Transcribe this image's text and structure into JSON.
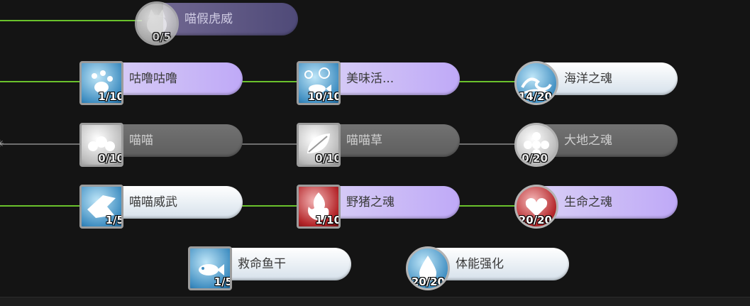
{
  "skill_tree": {
    "nodes": [
      {
        "id": "miao_jia_hu_wei",
        "label": "喵假虎威",
        "count": "0/5",
        "icon": "cat-face-icon",
        "state": "locked"
      },
      {
        "id": "gu_lu",
        "label": "咕噜咕噜",
        "count": "1/10",
        "icon": "cat-paws-icon",
        "state": "learned"
      },
      {
        "id": "mei_wei",
        "label": "美味活...",
        "count": "10/10",
        "icon": "fish-bubbles-icon",
        "state": "maxed"
      },
      {
        "id": "hai_yang",
        "label": "海洋之魂",
        "count": "14/20",
        "icon": "wave-icon",
        "state": "learned"
      },
      {
        "id": "miao_miao",
        "label": "喵喵",
        "count": "0/10",
        "icon": "cat-group-icon",
        "state": "locked"
      },
      {
        "id": "miao_miao_cao",
        "label": "喵喵草",
        "count": "0/10",
        "icon": "leaf-icon",
        "state": "locked"
      },
      {
        "id": "da_di",
        "label": "大地之魂",
        "count": "0/20",
        "icon": "flower-icon",
        "state": "locked"
      },
      {
        "id": "miao_miao_wei_wu",
        "label": "喵喵威武",
        "count": "1/5",
        "icon": "roaring-cat-icon",
        "state": "learned"
      },
      {
        "id": "ye_zhu",
        "label": "野猪之魂",
        "count": "1/10",
        "icon": "flame-boar-icon",
        "state": "learned-red"
      },
      {
        "id": "sheng_ming",
        "label": "生命之魂",
        "count": "20/20",
        "icon": "heart-icon",
        "state": "maxed-red"
      },
      {
        "id": "jiu_ming_yu_gan",
        "label": "救命鱼干",
        "count": "1/5",
        "icon": "dried-fish-icon",
        "state": "learned"
      },
      {
        "id": "ti_neng",
        "label": "体能强化",
        "count": "20/20",
        "icon": "water-drop-icon",
        "state": "maxed"
      }
    ]
  },
  "colors": {
    "active_line": "#6ac22c",
    "inactive_line": "#6e6e6e",
    "pill_light": "#d6e1eb",
    "pill_purple": "#bfa9f7",
    "pill_grey": "#5e5e5e",
    "background": "#141414"
  }
}
